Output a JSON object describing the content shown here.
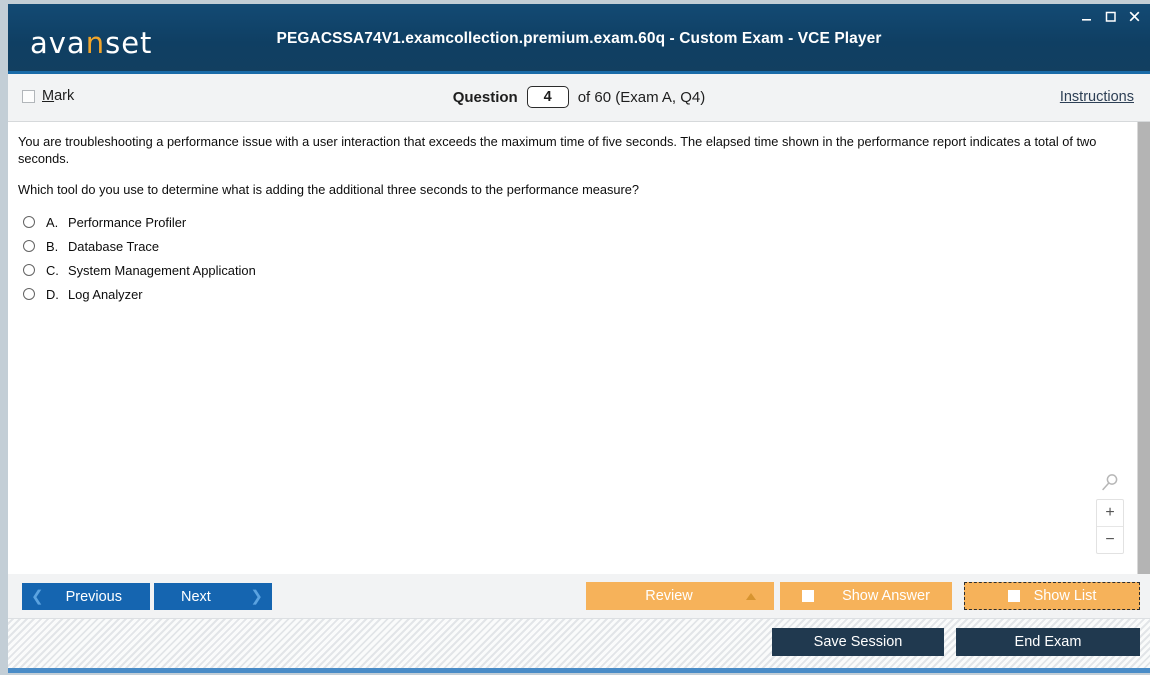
{
  "window": {
    "title": "PEGACSSA74V1.examcollection.premium.exam.60q - Custom Exam - VCE Player",
    "logo_prefix": "ava",
    "logo_accent": "n",
    "logo_suffix": "set",
    "controls": {
      "minimize": "minimize-icon",
      "maximize": "maximize-icon",
      "close": "close-icon"
    },
    "colors": {
      "titlebar": "#113f63",
      "accent_orange": "#f0a52b",
      "button_blue": "#1565b0",
      "button_orange": "#f6b25a",
      "button_dark": "#20394f",
      "footer_blue": "#4a8cc7"
    }
  },
  "qheader": {
    "mark_label_accel": "M",
    "mark_label_rest": "ark",
    "question_label": "Question",
    "question_number": "4",
    "question_of": "of 60 (Exam A, Q4)",
    "instructions_label": "Instructions"
  },
  "question": {
    "paragraph1": "You are troubleshooting a performance issue with a user interaction that exceeds the maximum time of five seconds. The elapsed time shown in the performance report indicates a total of two seconds.",
    "paragraph2": "Which tool do you use to determine what is adding the additional three seconds to the performance measure?",
    "options": [
      {
        "letter": "A.",
        "text": "Performance Profiler",
        "selected": false
      },
      {
        "letter": "B.",
        "text": "Database Trace",
        "selected": false
      },
      {
        "letter": "C.",
        "text": "System Management Application",
        "selected": false
      },
      {
        "letter": "D.",
        "text": "Log Analyzer",
        "selected": false
      }
    ]
  },
  "zoom_widget": {
    "magnifier_icon": "magnifier-icon",
    "zoom_in": "+",
    "zoom_out": "−"
  },
  "actionbar": {
    "previous_label": "Previous",
    "previous_icon": "chevron-left-icon",
    "next_label": "Next",
    "next_icon": "chevron-right-icon",
    "review_label": "Review",
    "review_icon": "triangle-up-icon",
    "show_answer_label": "Show Answer",
    "show_list_label": "Show List"
  },
  "footer": {
    "save_session_label": "Save Session",
    "end_exam_label": "End Exam"
  }
}
